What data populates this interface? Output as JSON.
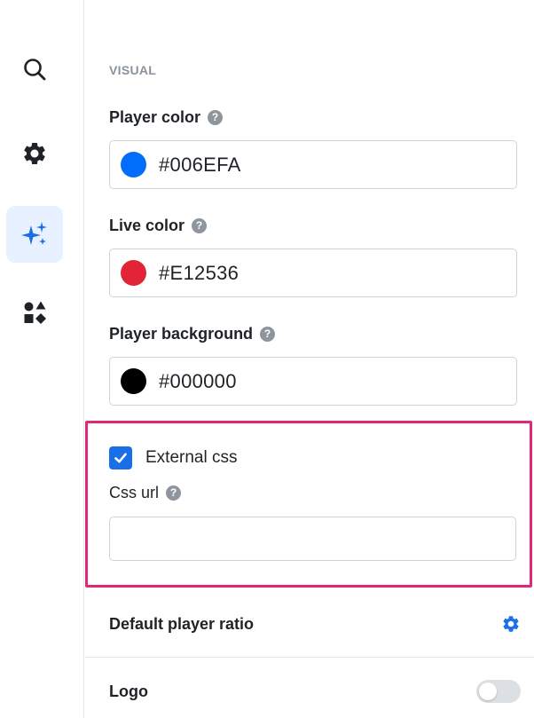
{
  "sidebar": {
    "items": [
      {
        "name": "search",
        "icon": "search-icon",
        "active": false
      },
      {
        "name": "settings",
        "icon": "gear-icon",
        "active": false
      },
      {
        "name": "visual",
        "icon": "sparkles-icon",
        "active": true
      },
      {
        "name": "widgets",
        "icon": "shapes-icon",
        "active": false
      }
    ]
  },
  "visual": {
    "section_label": "VISUAL",
    "player_color": {
      "label": "Player color",
      "value": "#006EFA",
      "swatch": "#006EFA"
    },
    "live_color": {
      "label": "Live color",
      "value": "#E12536",
      "swatch": "#E12536"
    },
    "player_background": {
      "label": "Player background",
      "value": "#000000",
      "swatch": "#000000"
    },
    "help_glyph": "?",
    "external_css": {
      "label": "External css",
      "checked": true
    },
    "css_url": {
      "label": "Css url",
      "value": "",
      "placeholder": ""
    },
    "default_player_ratio": {
      "label": "Default player ratio",
      "icon": "gear-icon"
    },
    "logo": {
      "label": "Logo",
      "toggle_on": false
    }
  },
  "colors": {
    "accent": "#1A6FE8",
    "highlight_border": "#E0287A",
    "active_nav_bg": "#E8F1FF"
  }
}
